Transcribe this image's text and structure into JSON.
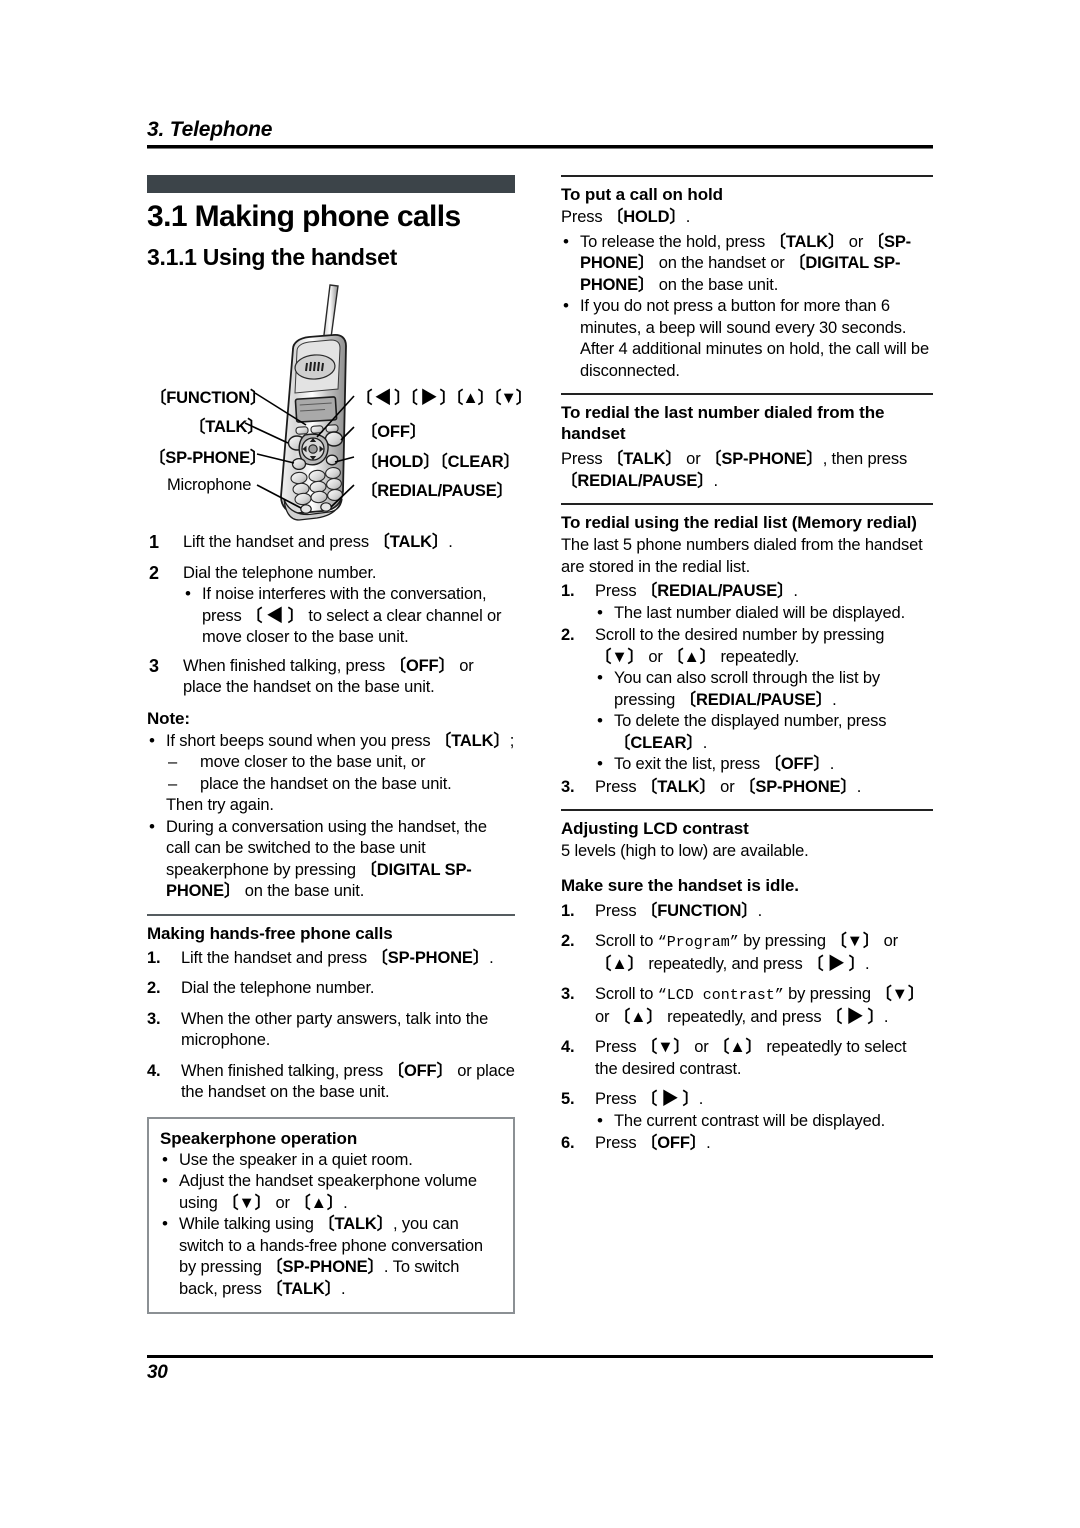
{
  "header": {
    "chapter": "3. Telephone"
  },
  "footer": {
    "page_number": "30"
  },
  "left": {
    "section_title": "3.1 Making phone calls",
    "subsection_title": "3.1.1 Using the handset",
    "figure": {
      "labels": {
        "function": "〔FUNCTION〕",
        "talk": "〔TALK〕",
        "sp_phone": "〔SP-PHONE〕",
        "microphone": "Microphone",
        "arrows": "〔 ◀ 〕〔 ▶ 〕〔▲〕〔▼〕",
        "off": "〔OFF〕",
        "hold_clear": "〔HOLD〕〔CLEAR〕",
        "redial_pause": "〔REDIAL/PAUSE〕"
      }
    },
    "steps": [
      {
        "n": "1",
        "text": "Lift the handset and press 〔TALK〕."
      },
      {
        "n": "2",
        "text": "Dial the telephone number."
      },
      {
        "n": "3",
        "text": "When finished talking, press 〔OFF〕 or place the handset on the base unit."
      }
    ],
    "step2_bullet": "If noise interferes with the conversation, press 〔 ◀ 〕 to select a clear channel or move closer to the base unit.",
    "note_label": "Note:",
    "note_bullets": [
      "If short beeps sound when you press 〔TALK〕;",
      "During a conversation using the handset, the call can be switched to the base unit speakerphone by pressing 〔DIGITAL SP-PHONE〕 on the base unit."
    ],
    "note_dashes": [
      "move closer to the base unit, or",
      "place the handset on the base unit."
    ],
    "note_then": "Then try again.",
    "handsfree_title": "Making hands-free phone calls",
    "handsfree_steps": [
      {
        "n": "1.",
        "text": "Lift the handset and press 〔SP-PHONE〕."
      },
      {
        "n": "2.",
        "text": "Dial the telephone number."
      },
      {
        "n": "3.",
        "text": "When the other party answers, talk into the microphone."
      },
      {
        "n": "4.",
        "text": "When finished talking, press 〔OFF〕 or place the handset on the base unit."
      }
    ],
    "speakerphone_box": {
      "title": "Speakerphone operation",
      "bullets": [
        "Use the speaker in a quiet room.",
        "Adjust the handset speakerphone volume using 〔▼〕 or 〔▲〕.",
        "While talking using 〔TALK〕, you can switch to a hands-free phone conversation by pressing 〔SP-PHONE〕. To switch back, press 〔TALK〕."
      ]
    }
  },
  "right": {
    "hold": {
      "title": "To put a call on hold",
      "intro": "Press 〔HOLD〕.",
      "bullets": [
        "To release the hold, press 〔TALK〕 or 〔SP-PHONE〕 on the handset or 〔DIGITAL SP-PHONE〕 on the base unit.",
        "If you do not press a button for more than 6 minutes, a beep will sound every 30 seconds. After 4 additional minutes on hold, the call will be disconnected."
      ]
    },
    "redial_last": {
      "title": "To redial the last number dialed from the handset",
      "body": "Press 〔TALK〕 or 〔SP-PHONE〕, then press 〔REDIAL/PAUSE〕."
    },
    "redial_list": {
      "title": "To redial using the redial list (Memory redial)",
      "intro": "The last 5 phone numbers dialed from the handset are stored in the redial list.",
      "steps": [
        {
          "n": "1.",
          "text": "Press 〔REDIAL/PAUSE〕."
        },
        {
          "n": "2.",
          "text": "Scroll to the desired number by pressing 〔▼〕 or 〔▲〕 repeatedly."
        },
        {
          "n": "3.",
          "text": "Press 〔TALK〕 or 〔SP-PHONE〕."
        }
      ],
      "step1_bullets": [
        "The last number dialed will be displayed."
      ],
      "step2_bullets": [
        "You can also scroll through the list by pressing 〔REDIAL/PAUSE〕.",
        "To delete the displayed number, press 〔CLEAR〕.",
        "To exit the list, press 〔OFF〕."
      ]
    },
    "lcd": {
      "title": "Adjusting LCD contrast",
      "intro": "5 levels (high to low) are available.",
      "idle_note": "Make sure the handset is idle.",
      "steps": [
        {
          "n": "1.",
          "text": "Press 〔FUNCTION〕."
        },
        {
          "n": "2.",
          "text": "Scroll to “Program” by pressing 〔▼〕 or 〔▲〕 repeatedly, and press 〔 ▶ 〕."
        },
        {
          "n": "3.",
          "text": "Scroll to “LCD contrast” by pressing 〔▼〕 or 〔▲〕 repeatedly, and press 〔 ▶ 〕."
        },
        {
          "n": "4.",
          "text": "Press 〔▼〕 or 〔▲〕 repeatedly to select the desired contrast."
        },
        {
          "n": "5.",
          "text": "Press 〔 ▶ 〕."
        },
        {
          "n": "6.",
          "text": "Press 〔OFF〕."
        }
      ],
      "step5_bullets": [
        "The current contrast will be displayed."
      ]
    }
  },
  "colors": {
    "section_bar": "#3c4449",
    "rule": "#555c60",
    "box_border": "#8b9094",
    "text": "#000000"
  }
}
